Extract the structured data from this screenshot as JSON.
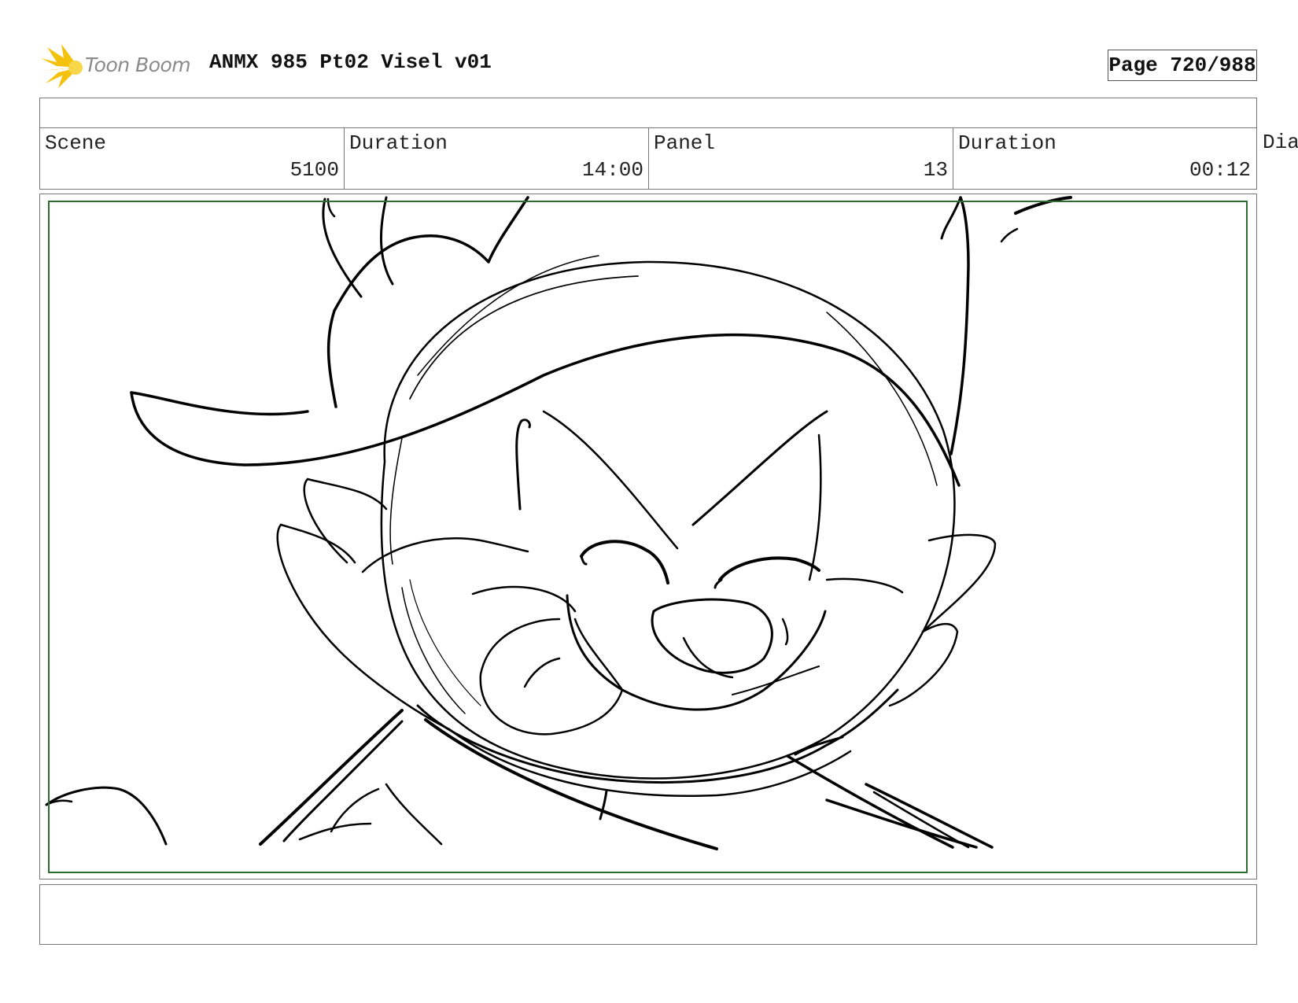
{
  "brand": {
    "logo_text": "Toon Boom",
    "logo_color": "#f4c20d"
  },
  "document": {
    "title": "ANMX 985 Pt02 Visel v01",
    "page_label": "Page 720/988"
  },
  "info_row": {
    "scene_label": "Scene",
    "scene_value": "5100",
    "scene_duration_label": "Duration",
    "scene_duration_value": "14:00",
    "panel_label": "Panel",
    "panel_value": "13",
    "panel_duration_label": "Duration",
    "panel_duration_value": "00:12",
    "dialogue_label": "Dia"
  },
  "panel": {
    "safe_area_color": "#2e6b2e",
    "subject": "character-face-sketch"
  },
  "action_notes": ""
}
